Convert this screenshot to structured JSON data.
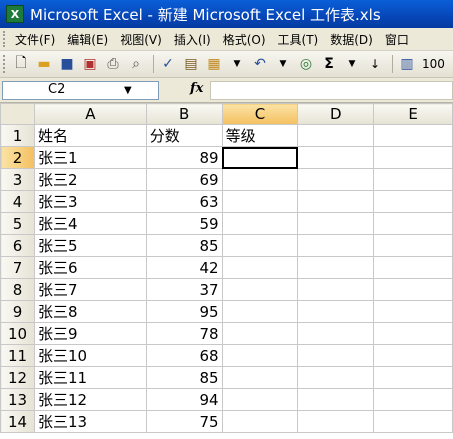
{
  "window": {
    "title": "Microsoft Excel - 新建 Microsoft Excel 工作表.xls"
  },
  "menu": [
    "文件(F)",
    "编辑(E)",
    "视图(V)",
    "插入(I)",
    "格式(O)",
    "工具(T)",
    "数据(D)",
    "窗口"
  ],
  "toolbar": {
    "zoom": "100"
  },
  "formula_bar": {
    "name_box": "C2",
    "fx_label": "fx",
    "formula": ""
  },
  "sheet": {
    "columns": [
      "A",
      "B",
      "C",
      "D",
      "E"
    ],
    "rows": [
      {
        "num": "1",
        "a": "姓名",
        "b": "分数",
        "c": "等级"
      },
      {
        "num": "2",
        "a": "张三1",
        "b": "89",
        "c": ""
      },
      {
        "num": "3",
        "a": "张三2",
        "b": "69",
        "c": ""
      },
      {
        "num": "4",
        "a": "张三3",
        "b": "63",
        "c": ""
      },
      {
        "num": "5",
        "a": "张三4",
        "b": "59",
        "c": ""
      },
      {
        "num": "6",
        "a": "张三5",
        "b": "85",
        "c": ""
      },
      {
        "num": "7",
        "a": "张三6",
        "b": "42",
        "c": ""
      },
      {
        "num": "8",
        "a": "张三7",
        "b": "37",
        "c": ""
      },
      {
        "num": "9",
        "a": "张三8",
        "b": "95",
        "c": ""
      },
      {
        "num": "10",
        "a": "张三9",
        "b": "78",
        "c": ""
      },
      {
        "num": "11",
        "a": "张三10",
        "b": "68",
        "c": ""
      },
      {
        "num": "12",
        "a": "张三11",
        "b": "85",
        "c": ""
      },
      {
        "num": "13",
        "a": "张三12",
        "b": "94",
        "c": ""
      },
      {
        "num": "14",
        "a": "张三13",
        "b": "75",
        "c": ""
      }
    ]
  }
}
